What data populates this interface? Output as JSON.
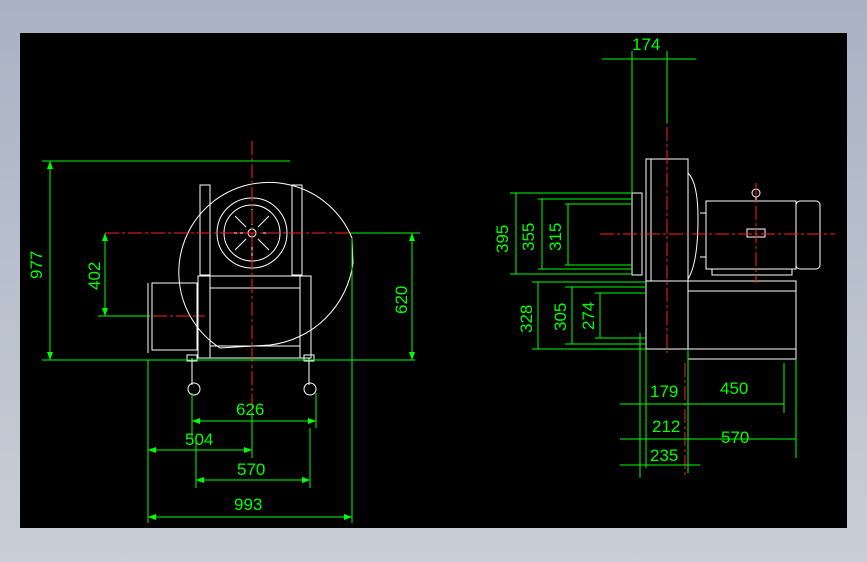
{
  "colors": {
    "window_bg": "#b8c0cc",
    "canvas_bg": "#000000",
    "dimension": "#00ff00",
    "outline": "#ffffff",
    "center_line": "#ff2020"
  },
  "front_view": {
    "dim_overall_height": "977",
    "dim_inlet_height": "402",
    "dim_outlet_height": "620",
    "dim_wheel_spacing": "626",
    "dim_offset": "504",
    "dim_base_width": "570",
    "dim_overall_width": "993"
  },
  "side_view": {
    "dim_top_width": "174",
    "dim_flange_395": "395",
    "dim_flange_355": "355",
    "dim_flange_315": "315",
    "dim_lower_328": "328",
    "dim_lower_305": "305",
    "dim_lower_274": "274",
    "dim_bottom_179": "179",
    "dim_bottom_450": "450",
    "dim_bottom_212": "212",
    "dim_bottom_570": "570",
    "dim_bottom_235": "235"
  }
}
